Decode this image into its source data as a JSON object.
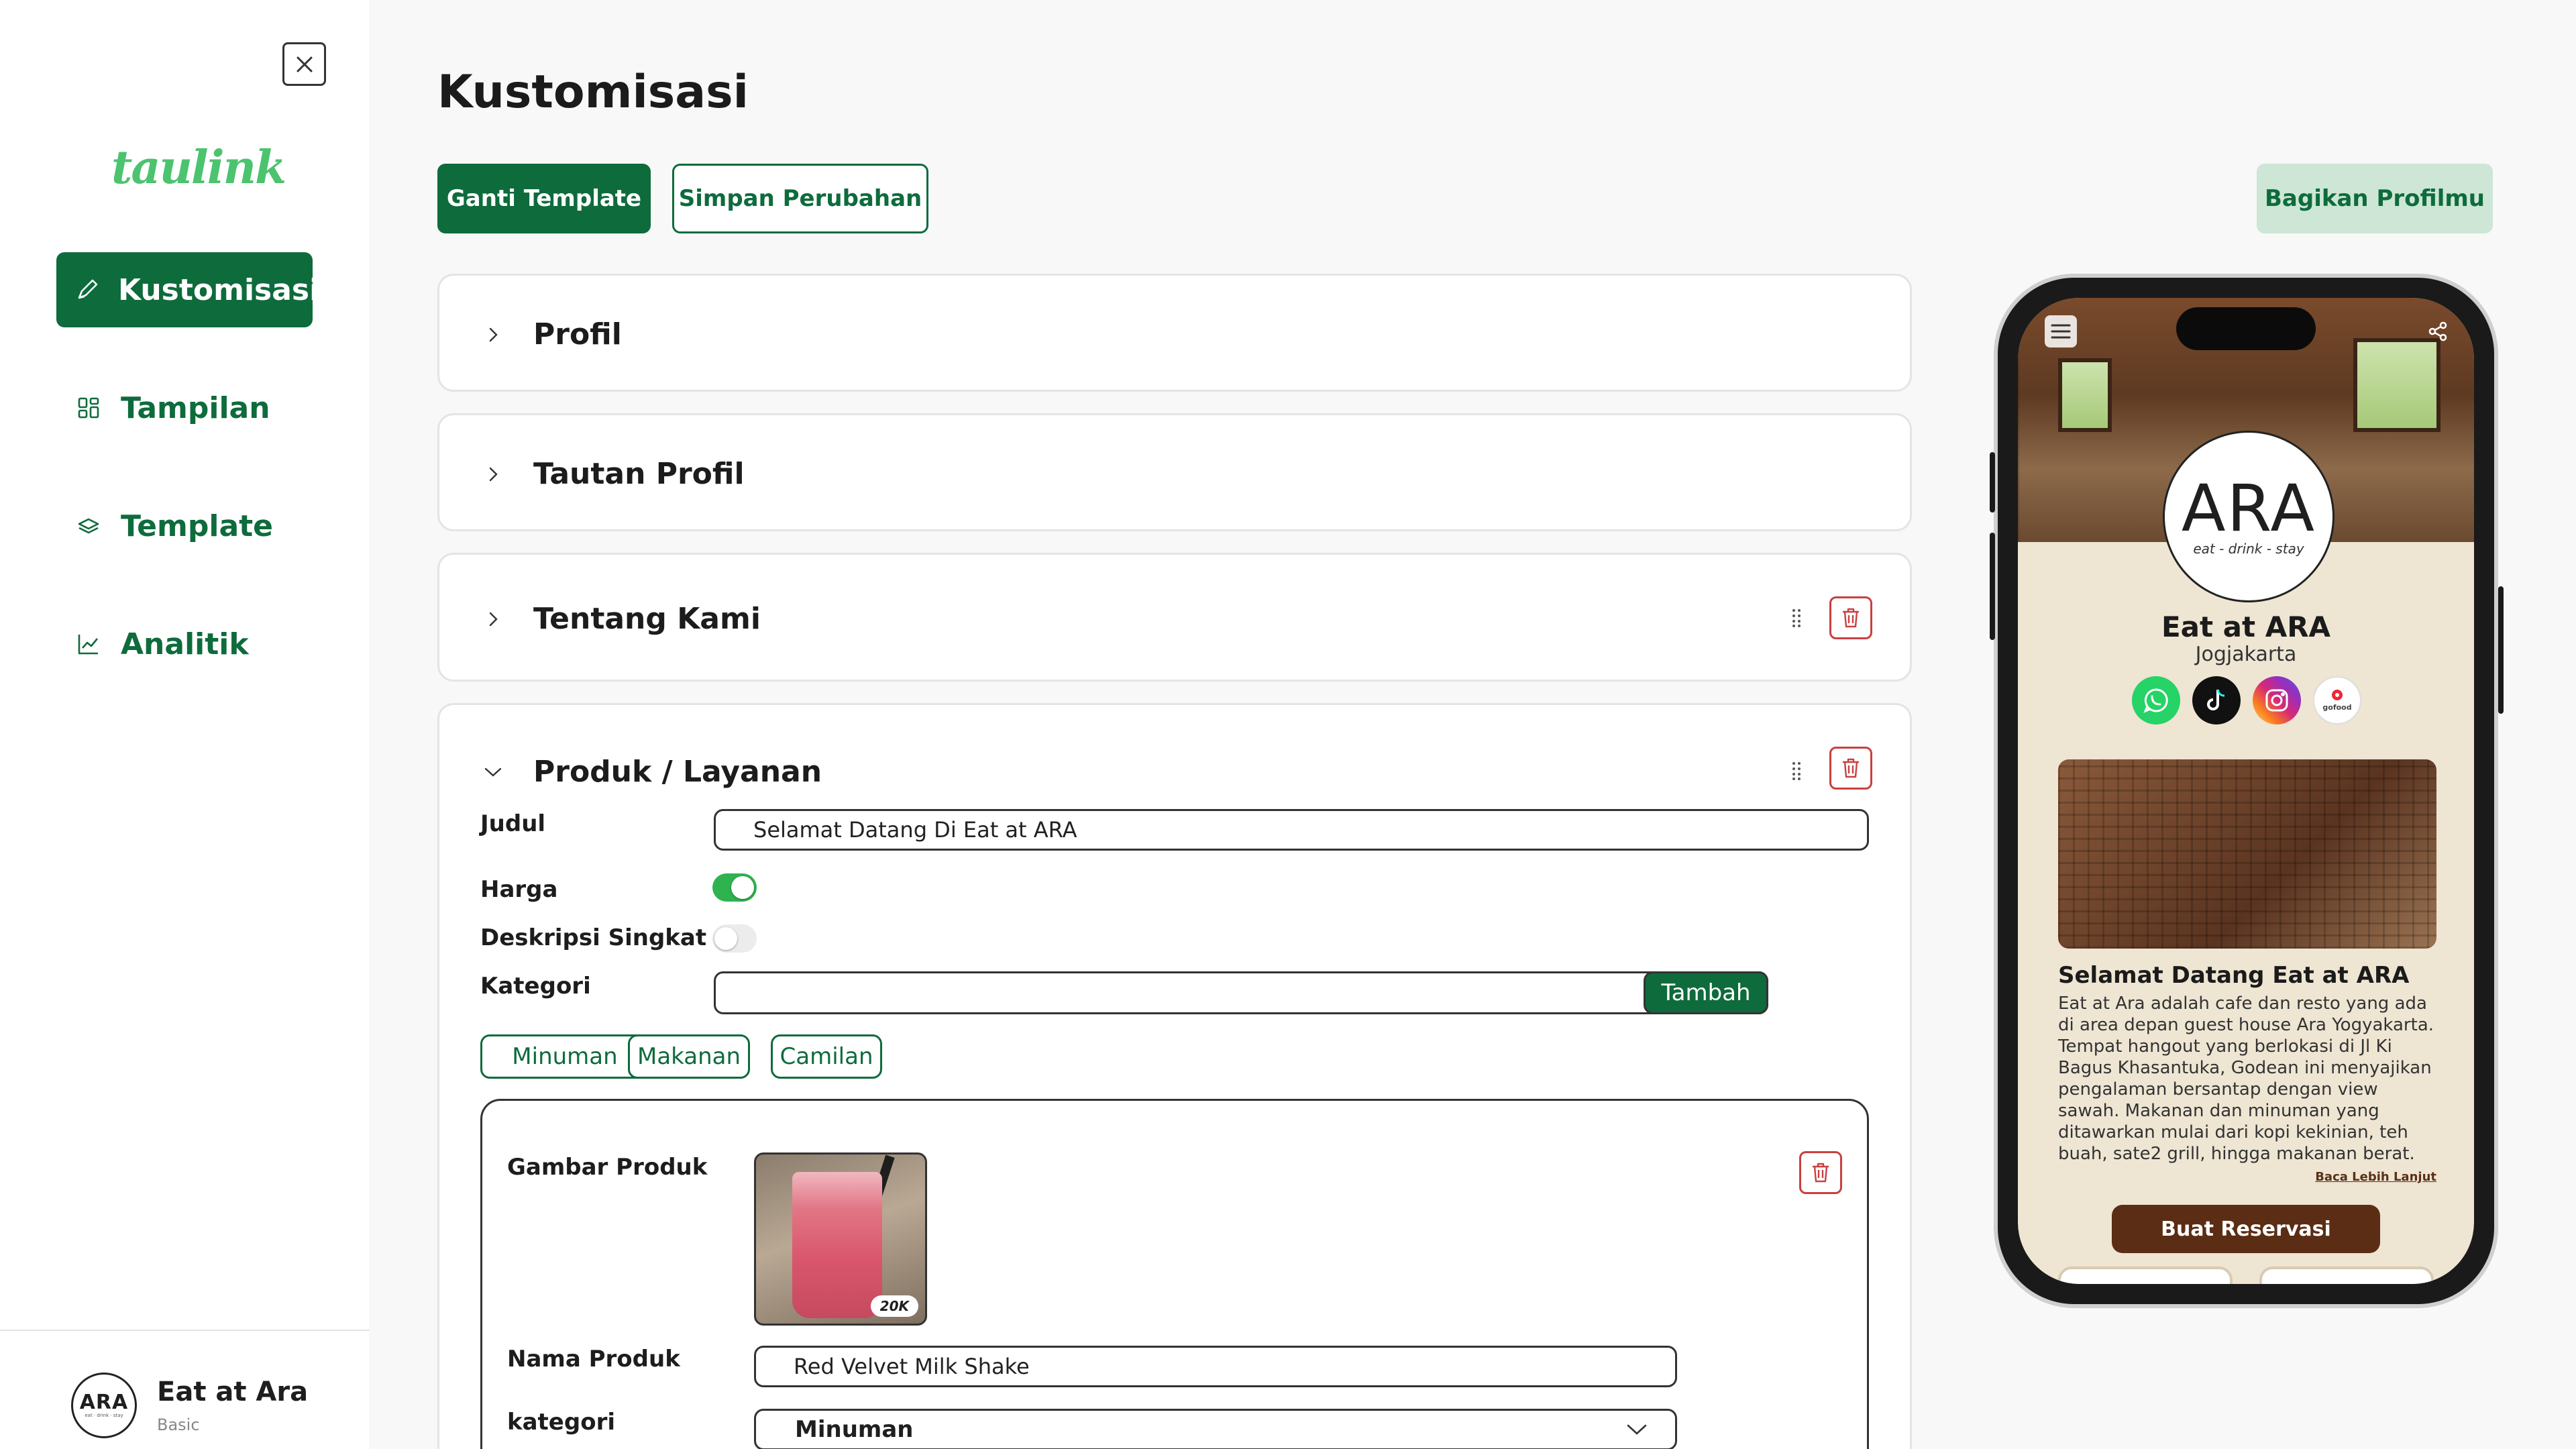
{
  "sidebar": {
    "logo": "taulink",
    "close_icon": "close-icon",
    "items": [
      {
        "label": "Kustomisasi",
        "icon": "pencil-icon",
        "active": true
      },
      {
        "label": "Tampilan",
        "icon": "grid-icon",
        "active": false
      },
      {
        "label": "Template",
        "icon": "layers-icon",
        "active": false
      },
      {
        "label": "Analitik",
        "icon": "chart-icon",
        "active": false
      }
    ],
    "account": {
      "name": "Eat at Ara",
      "plan": "Basic",
      "avatar_text": "ARA",
      "avatar_sub": "eat · drink · stay"
    }
  },
  "main": {
    "title": "Kustomisasi",
    "buttons": {
      "change_template": "Ganti Template",
      "save": "Simpan Perubahan",
      "share": "Bagikan Profilmu"
    },
    "sections": [
      {
        "title": "Profil",
        "expanded": false
      },
      {
        "title": "Tautan Profil",
        "expanded": false
      },
      {
        "title": "Tentang Kami",
        "expanded": false
      },
      {
        "title": "Produk / Layanan",
        "expanded": true
      }
    ],
    "produk": {
      "judul_label": "Judul",
      "judul_value": "Selamat Datang Di Eat at ARA",
      "harga_label": "Harga",
      "harga_on": true,
      "deskripsi_label": "Deskripsi Singkat",
      "deskripsi_on": false,
      "kategori_label": "Kategori",
      "kategori_value": "",
      "tambah_label": "Tambah",
      "chips": [
        "Minuman",
        "Makanan",
        "Camilan"
      ],
      "item": {
        "gambar_label": "Gambar Produk",
        "price_badge": "20K",
        "nama_label": "Nama Produk",
        "nama_value": "Red Velvet Milk Shake",
        "kategori_label": "kategori",
        "kategori_value": "Minuman"
      }
    }
  },
  "preview": {
    "logo_text": "ARA",
    "logo_sub": "eat - drink - stay",
    "name": "Eat at ARA",
    "city": "Jogjakarta",
    "socials": [
      {
        "name": "whatsapp-icon",
        "color": "#25d366"
      },
      {
        "name": "tiktok-icon",
        "color": "#111111"
      },
      {
        "name": "instagram-icon",
        "color": "#d62976"
      },
      {
        "name": "gofood-icon",
        "color": "#ffffff",
        "label": "gofood"
      }
    ],
    "about_title": "Selamat Datang Eat at ARA",
    "about_text": "Eat at Ara adalah cafe dan resto yang ada di area depan guest house Ara Yogyakarta. Tempat hangout yang berlokasi di Jl Ki Bagus Khasantuka, Godean ini menyajikan pengalaman bersantap dengan view sawah. Makanan dan minuman yang ditawarkan mulai dari kopi kekinian, teh buah, sate2 grill, hingga makanan berat.",
    "read_more": "Baca Lebih Lanjut",
    "reserve": "Buat Reservasi"
  },
  "colors": {
    "brand": "#0e6b3c",
    "brand_light": "#cde6d6",
    "logo_green": "#4cc36f",
    "danger": "#c94040",
    "toggle_on": "#2fb34f",
    "phone_accent": "#5a2d14"
  }
}
